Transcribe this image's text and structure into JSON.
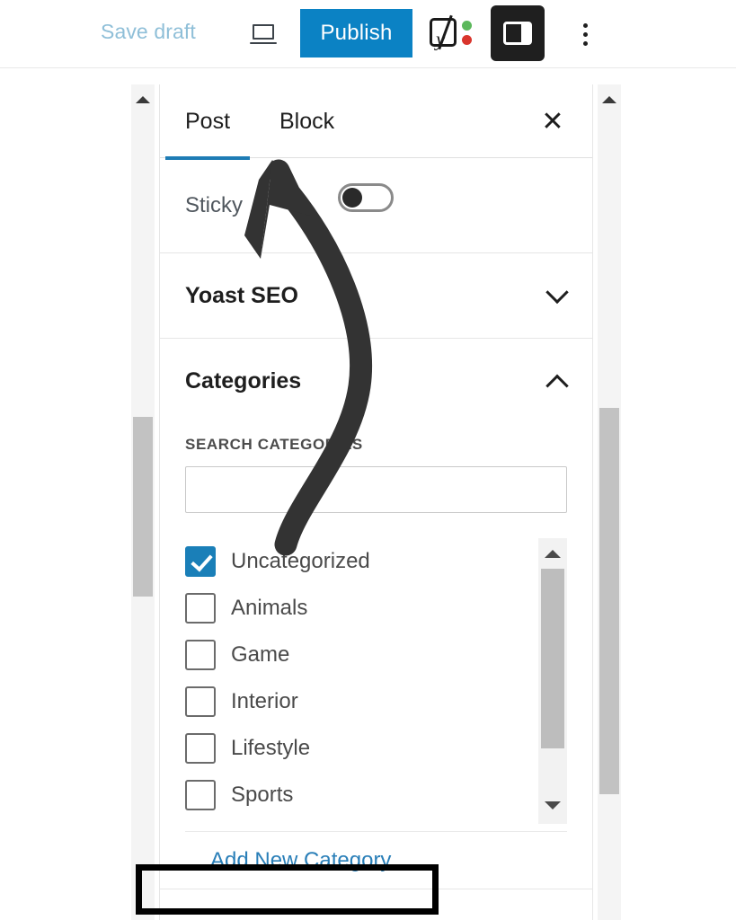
{
  "toolbar": {
    "save_draft_label": "Save draft",
    "preview_icon": "laptop-preview-icon",
    "publish_label": "Publish",
    "yoast_icon": "yoast-seo-icon",
    "sidebar_toggle_icon": "settings-sidebar-icon",
    "more_menu_icon": "more-options-vertical-dots-icon",
    "publish_color": "#0b82c4",
    "save_draft_color": "#8fbfd8"
  },
  "panel": {
    "tabs": [
      {
        "label": "Post",
        "active": true
      },
      {
        "label": "Block",
        "active": false
      }
    ],
    "close_label": "✕",
    "active_tab_underline_color": "#1e7cb5",
    "sticky": {
      "label": "Sticky",
      "toggle_state": "off"
    },
    "sections": [
      {
        "title": "Yoast SEO",
        "expanded": false,
        "chevron": "chevron-down-icon"
      },
      {
        "title": "Categories",
        "expanded": true,
        "chevron": "chevron-up-icon"
      }
    ],
    "categories": {
      "search_label": "SEARCH CATEGORIES",
      "search_value": "",
      "search_placeholder": "",
      "items": [
        {
          "label": "Uncategorized",
          "checked": true
        },
        {
          "label": "Animals",
          "checked": false
        },
        {
          "label": "Game",
          "checked": false
        },
        {
          "label": "Interior",
          "checked": false
        },
        {
          "label": "Lifestyle",
          "checked": false
        },
        {
          "label": "Sports",
          "checked": false
        }
      ],
      "checked_color": "#1a7fb8",
      "scroll_up_icon": "scroll-up-arrow-icon",
      "scroll_down_icon": "scroll-down-arrow-icon",
      "add_new_category_label": "Add New Category",
      "add_new_category_color": "#2a7fb8"
    }
  },
  "scrollbars": {
    "left_up_arrow_icon": "scroll-up-arrow-icon",
    "right_up_arrow_icon": "scroll-up-arrow-icon"
  },
  "annotations": {
    "arrow_color": "#333333",
    "arrow_description": "curved-arrow-pointing-to-sticky-toggle",
    "highlight_box_color": "#000000",
    "highlight_target": "Add New Category"
  }
}
